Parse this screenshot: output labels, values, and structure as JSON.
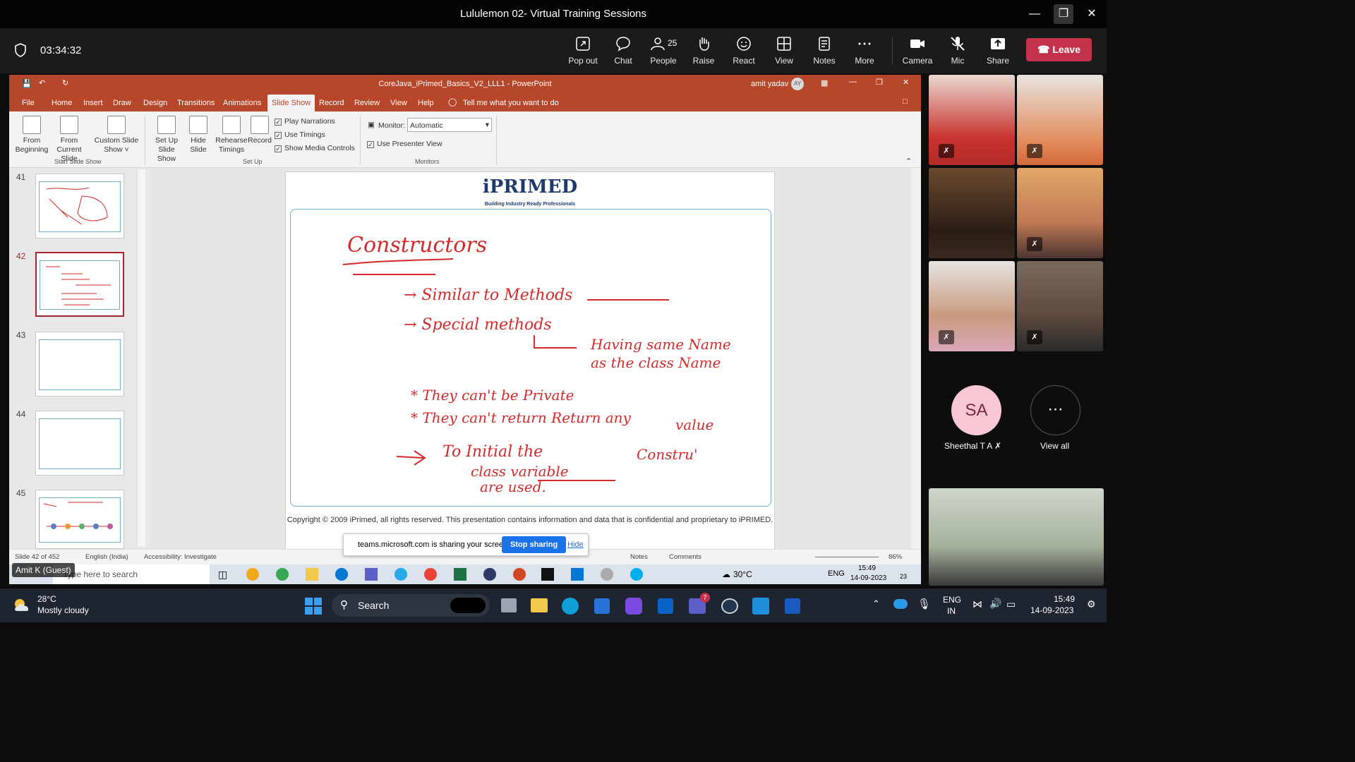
{
  "window": {
    "title": "Lululemon 02- Virtual Training Sessions"
  },
  "meeting": {
    "timer": "03:34:32",
    "toolbar": [
      {
        "label": "Pop out",
        "icon": "pop-out-icon"
      },
      {
        "label": "Chat",
        "icon": "chat-icon"
      },
      {
        "label": "People",
        "icon": "people-icon",
        "count": "25"
      },
      {
        "label": "Raise",
        "icon": "raise-hand-icon"
      },
      {
        "label": "React",
        "icon": "react-icon"
      },
      {
        "label": "View",
        "icon": "view-icon"
      },
      {
        "label": "Notes",
        "icon": "notes-icon"
      },
      {
        "label": "More",
        "icon": "more-icon"
      },
      {
        "label": "Camera",
        "icon": "camera-icon"
      },
      {
        "label": "Mic",
        "icon": "mic-off-icon"
      },
      {
        "label": "Share",
        "icon": "share-icon"
      }
    ],
    "leave_label": "Leave",
    "leave_color": "#c4314b"
  },
  "powerpoint": {
    "doc_title": "CoreJava_iPrimed_Basics_V2_LLL1  -  PowerPoint",
    "user": "amit yadav",
    "user_initials": "AY",
    "menu": [
      "File",
      "Home",
      "Insert",
      "Draw",
      "Design",
      "Transitions",
      "Animations",
      "Slide Show",
      "Record",
      "Review",
      "View",
      "Help"
    ],
    "active_tab": "Slide Show",
    "tell_me": "Tell me what you want to do",
    "ribbon": {
      "from_beginning": "From Beginning",
      "from_current": "From Current Slide",
      "custom_show": "Custom Slide Show",
      "group_start": "Start Slide Show",
      "setup_show": "Set Up Slide Show",
      "hide_slide": "Hide Slide",
      "rehearse": "Rehearse Timings",
      "record": "Record",
      "play_narrations": "Play Narrations",
      "use_timings": "Use Timings",
      "show_media": "Show Media Controls",
      "group_setup": "Set Up",
      "monitor_label": "Monitor:",
      "monitor_value": "Automatic",
      "presenter_view": "Use Presenter View",
      "group_monitors": "Monitors"
    },
    "thumbnails": [
      {
        "num": "41",
        "selected": false
      },
      {
        "num": "42",
        "selected": true
      },
      {
        "num": "43",
        "selected": false
      },
      {
        "num": "44",
        "selected": false
      },
      {
        "num": "45",
        "selected": false
      }
    ],
    "slide": {
      "logo": "iPRIMED",
      "tagline": "Building Industry Ready Professionals",
      "copyright": "Copyright © 2009 iPrimed, all rights reserved. This presentation contains information  and data  that is confidential and proprietary to iPRIMED.",
      "handwriting": {
        "heading": "Constructors",
        "l1": "→  Similar to Methods",
        "l2": "→  Special methods",
        "l3": "Having same Name",
        "l4": "as the class Name",
        "l5": "*  They can't be Private",
        "l6": "*  They can't return Return any",
        "l7": "value",
        "l8": "To Initial the",
        "l9": "Constru'",
        "l10": "class variable",
        "l11": "are used."
      },
      "ink_color": "#d42a2a"
    },
    "status": {
      "slide_of": "Slide 42 of 452",
      "language": "English (India)",
      "accessibility": "Accessibility: Investigate",
      "notes": "Notes",
      "comments": "Comments",
      "zoom": "86%"
    },
    "sharing_bar": {
      "text": "teams.microsoft.com is sharing your screen.",
      "stop": "Stop sharing",
      "hide": "Hide"
    },
    "inner_taskbar": {
      "search": "Type here to search",
      "weather": "30°C",
      "lang": "ENG",
      "time": "15:49",
      "date": "14-09-2023",
      "notif": "23"
    }
  },
  "guest_label": "Amit K (Guest)",
  "participants": {
    "sa_initials": "SA",
    "sa_name": "Sheethal T A",
    "view_all": "View all"
  },
  "taskbar": {
    "temp": "28°C",
    "weather": "Mostly cloudy",
    "search": "Search",
    "lang1": "ENG",
    "lang2": "IN",
    "time": "15:49",
    "date": "14-09-2023",
    "teams_badge": "7"
  }
}
